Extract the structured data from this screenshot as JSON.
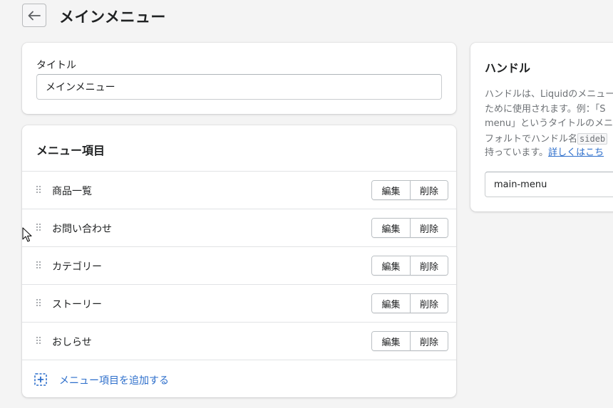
{
  "header": {
    "back_icon": "arrow-left-icon",
    "title": "メインメニュー"
  },
  "title_card": {
    "label": "タイトル",
    "value": "メインメニュー"
  },
  "menu_card": {
    "heading": "メニュー項目",
    "drag_icon": "drag-handle-icon",
    "items": [
      {
        "label": "商品一覧",
        "edit": "編集",
        "delete": "削除"
      },
      {
        "label": "お問い合わせ",
        "edit": "編集",
        "delete": "削除"
      },
      {
        "label": "カテゴリー",
        "edit": "編集",
        "delete": "削除"
      },
      {
        "label": "ストーリー",
        "edit": "編集",
        "delete": "削除"
      },
      {
        "label": "おしらせ",
        "edit": "編集",
        "delete": "削除"
      }
    ],
    "add_icon": "add-square-icon",
    "add_label": "メニュー項目を追加する"
  },
  "handle_card": {
    "heading": "ハンドル",
    "desc_line1": "ハンドルは、Liquidのメニュー",
    "desc_line2": "ために使用されます。例：「S",
    "desc_line3": "menu」というタイトルのメニュ",
    "desc_line4_prefix": "フォルトでハンドル名",
    "desc_line4_code": "sideb",
    "desc_line5_prefix": "持っています。",
    "learn_more": "詳しくはこち",
    "value": "main-menu"
  },
  "colors": {
    "background": "#f4f4f4",
    "link": "#2c6ecb",
    "text": "#202223",
    "muted_text": "#6d7175"
  }
}
